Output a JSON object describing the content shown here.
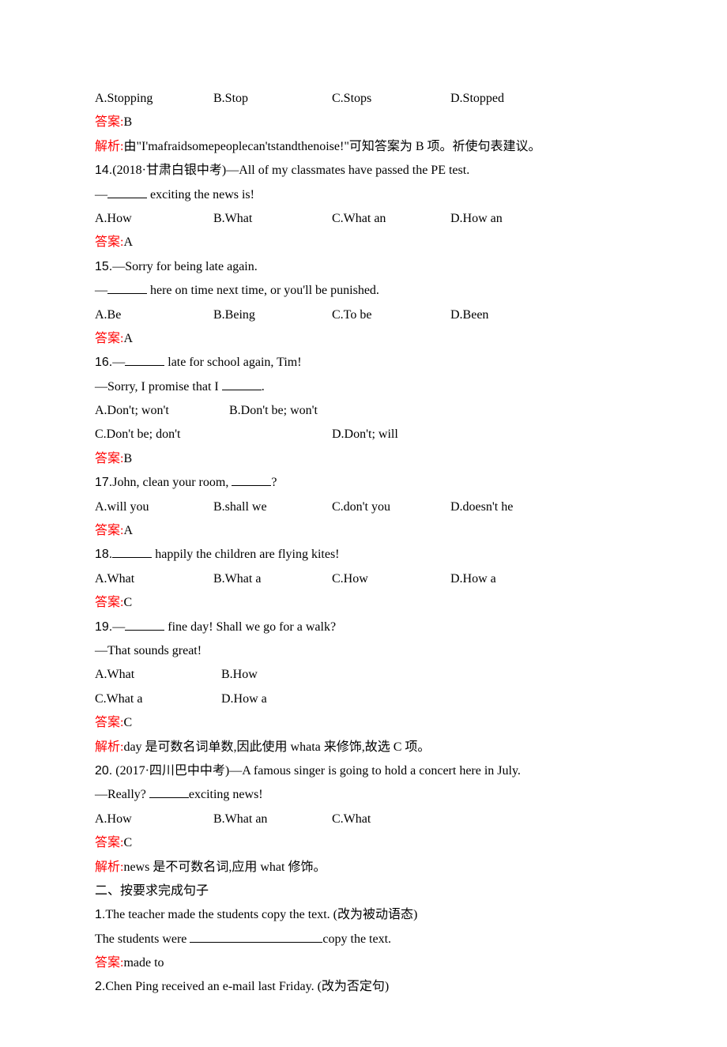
{
  "colors": {
    "answer": "#ff0000"
  },
  "labels": {
    "answer": "答案:",
    "explain": "解析:"
  },
  "q13": {
    "optA": "A.Stopping",
    "optB": "B.Stop",
    "optC": "C.Stops",
    "optD": "D.Stopped",
    "answer": "B",
    "explain": "由\"I'mafraidsomepeoplecan'tstandthenoise!\"可知答案为 B 项。祈使句表建议。"
  },
  "q14": {
    "num": "14.",
    "src": "(2018·甘肃白银中考)",
    "line1": "—All of my classmates have passed the PE test.",
    "line2a": "—",
    "line2b": " exciting the news is!",
    "optA": "A.How",
    "optB": "B.What",
    "optC": "C.What an",
    "optD": "D.How an",
    "answer": "A"
  },
  "q15": {
    "num": "15.",
    "line1": "—Sorry for being late again.",
    "line2a": "—",
    "line2b": " here on time next time, or you'll be punished.",
    "optA": "A.Be",
    "optB": "B.Being",
    "optC": "C.To be",
    "optD": "D.Been",
    "answer": "A"
  },
  "q16": {
    "num": "16.",
    "line1a": "—",
    "line1b": " late for school again, Tim!",
    "line2a": "—Sorry, I promise that I ",
    "line2b": ".",
    "optA": "A.Don't; won't",
    "optB": "B.Don't be; won't",
    "optC": "C.Don't be; don't",
    "optD": "D.Don't; will",
    "answer": "B"
  },
  "q17": {
    "num": "17.",
    "line1a": "John, clean your room, ",
    "line1b": "?",
    "optA": "A.will you",
    "optB": "B.shall we",
    "optC": "C.don't you",
    "optD": "D.doesn't he",
    "answer": "A"
  },
  "q18": {
    "num": "18.",
    "line1b": " happily the children are flying kites!",
    "optA": "A.What",
    "optB": "B.What a",
    "optC": "C.How",
    "optD": "D.How a",
    "answer": "C"
  },
  "q19": {
    "num": "19.",
    "line1a": "—",
    "line1b": " fine day! Shall we go for a walk?",
    "line2": "—That sounds great!",
    "optA": "A.What",
    "optB": "B.How",
    "optC": "C.What a",
    "optD": "D.How a",
    "answer": "C",
    "explain": "day 是可数名词单数,因此使用 whata 来修饰,故选 C 项。"
  },
  "q20": {
    "num": "20.",
    "src": " (2017·四川巴中中考)",
    "line1": "—A famous singer is going to hold a concert here in July.",
    "line2a": "—Really? ",
    "line2b": "exciting news!",
    "optA": "A.How",
    "optB": "B.What an",
    "optC": "C.What",
    "answer": "C",
    "explain": "news 是不可数名词,应用 what 修饰。"
  },
  "section2_title": "二、按要求完成句子",
  "s2q1": {
    "num": "1.",
    "line1": "The teacher made the students copy the text. (改为被动语态)",
    "line2a": "The students were ",
    "line2b": "copy the text.",
    "answer": "made to"
  },
  "s2q2": {
    "num": "2.",
    "line1": "Chen Ping received an e-mail last Friday. (改为否定句)"
  }
}
